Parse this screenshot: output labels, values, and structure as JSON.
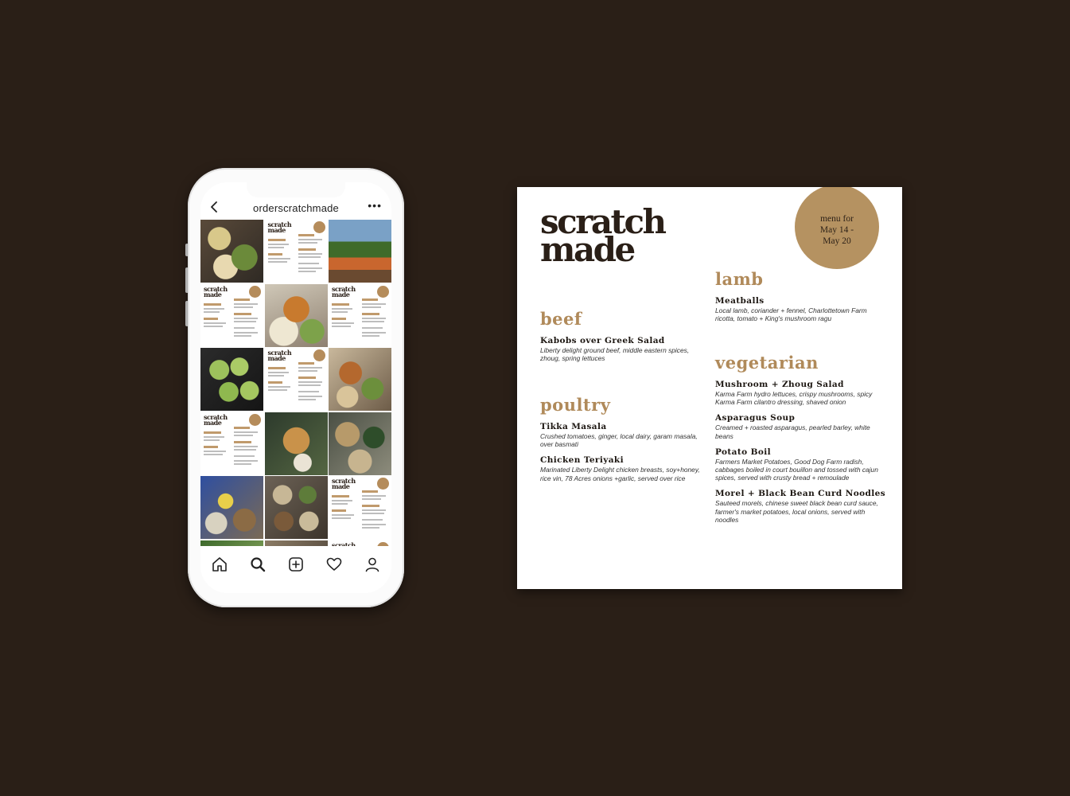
{
  "phone": {
    "username": "orderscratchmade",
    "more_label": "•••",
    "menu_tile_logo": [
      "scratch",
      "made"
    ],
    "grid_tiles": [
      "food-a",
      "menu",
      "food-c",
      "menu",
      "food-b",
      "menu",
      "food-d",
      "menu",
      "food-e",
      "menu",
      "food-f",
      "food-g",
      "food-h",
      "food-i",
      "menu",
      "food-j",
      "food-k",
      "menu"
    ],
    "nav_icons": [
      "home-icon",
      "search-icon",
      "add-post-icon",
      "heart-icon",
      "profile-icon"
    ]
  },
  "menu_card": {
    "logo_line1": "scratch",
    "logo_line2": "made",
    "badge_line1": "menu for",
    "badge_line2": "May 14 -",
    "badge_line3": "May 20",
    "sections": {
      "beef": {
        "title": "beef",
        "items": [
          {
            "name": "Kabobs over Greek Salad",
            "desc": "Liberty delight ground beef, middle eastern spices, zhoug, spring lettuces"
          }
        ]
      },
      "poultry": {
        "title": "poultry",
        "items": [
          {
            "name": "Tikka Masala",
            "desc": "Crushed tomatoes, ginger, local dairy, garam masala, over basmati"
          },
          {
            "name": "Chicken Teriyaki",
            "desc": "Marinated Liberty Delight chicken breasts, soy+honey, rice vin, 78 Acres onions +garlic, served over rice"
          }
        ]
      },
      "lamb": {
        "title": "lamb",
        "items": [
          {
            "name": "Meatballs",
            "desc": "Local lamb, coriander + fennel, Charlottetown Farm ricotta, tomato + King's mushroom ragu"
          }
        ]
      },
      "vegetarian": {
        "title": "vegetarian",
        "items": [
          {
            "name": "Mushroom + Zhoug Salad",
            "desc": "Karma Farm hydro lettuces, crispy mushrooms, spicy Karma Farm cilantro dressing, shaved onion"
          },
          {
            "name": "Asparagus Soup",
            "desc": "Creamed + roasted asparagus, pearled barley, white beans"
          },
          {
            "name": "Potato Boil",
            "desc": "Farmers Market Potatoes, Good Dog Farm radish, cabbages boiled in court bouillon and tossed with cajun spices, served with crusty bread + remoulade"
          },
          {
            "name": "Morel + Black Bean Curd Noodles",
            "desc": "Sauteed morels, chinese sweet black bean curd sauce, farmer's market potatoes, local onions, served with noodles"
          }
        ]
      }
    }
  },
  "colors": {
    "background": "#2a1f17",
    "accent": "#b08a5a",
    "badge": "#b59261"
  }
}
